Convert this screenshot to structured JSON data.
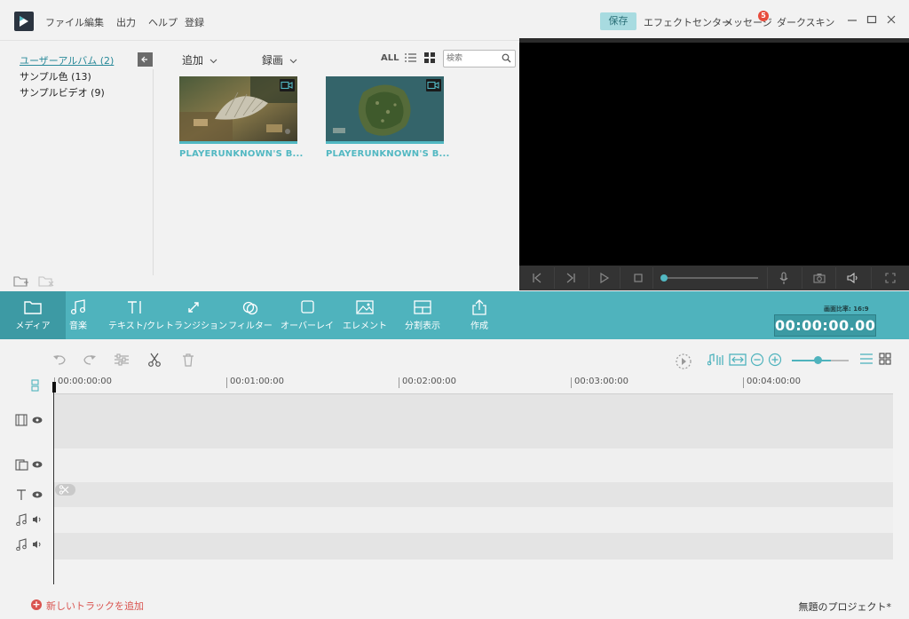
{
  "menu": [
    "ファイル",
    "編集",
    "出力",
    "ヘルプ",
    "登録"
  ],
  "header": {
    "save": "保存",
    "effects_center": "エフェクトセンター",
    "messages": "メッセージ",
    "messages_badge": "5",
    "dark_skin": "ダークスキン"
  },
  "library": {
    "tree": [
      "ユーザーアルバム (2)",
      "サンプル色 (13)",
      "サンプルビデオ (9)"
    ],
    "add_label": "追加",
    "record_label": "録画",
    "all_label": "ALL",
    "search_placeholder": "検索",
    "clips": [
      {
        "label": "PLAYERUNKNOWN'S B..."
      },
      {
        "label": "PLAYERUNKNOWN'S B..."
      }
    ]
  },
  "toolbar": {
    "tools": [
      "メディア",
      "音楽",
      "テキスト/クレ",
      "トランジション",
      "フィルター",
      "オーバーレイ",
      "エレメント",
      "分割表示",
      "作成"
    ],
    "aspect": "画面比率: 16:9",
    "timecode": "00:00:00.00"
  },
  "timeline": {
    "ruler": [
      "00:00:00:00",
      "00:01:00:00",
      "00:02:00:00",
      "00:03:00:00",
      "00:04:00:00"
    ],
    "add_track": "新しいトラックを追加",
    "project_name": "無題のプロジェクト*"
  },
  "colors": {
    "accent": "#4fb3bd",
    "accent_dark": "#3d9aa4",
    "save_bg": "#a8dbe0",
    "badge": "#e74c3c"
  }
}
